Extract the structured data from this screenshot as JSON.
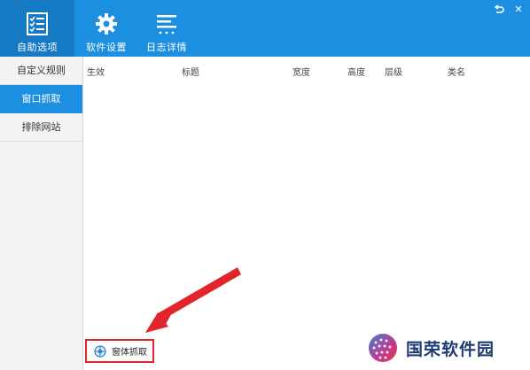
{
  "toolbar": {
    "items": [
      {
        "label": "自助选项",
        "icon": "checklist-icon",
        "active": true
      },
      {
        "label": "软件设置",
        "icon": "gear-icon",
        "active": false
      },
      {
        "label": "日志详情",
        "icon": "log-lines-icon",
        "active": false
      }
    ],
    "controls": {
      "restore_icon": "restore-arrow-icon",
      "close_label": "×"
    }
  },
  "sidebar": {
    "items": [
      {
        "label": "自定义规则",
        "active": false
      },
      {
        "label": "窗口抓取",
        "active": true
      },
      {
        "label": "排除网站",
        "active": false
      }
    ]
  },
  "table": {
    "columns": [
      "生效",
      "标题",
      "宽度",
      "高度",
      "层级",
      "类名"
    ],
    "rows": []
  },
  "action": {
    "label": "窗体抓取",
    "icon": "capture-target-icon",
    "highlight_color": "#e0262a"
  },
  "annotation": {
    "arrow_color": "#e0262a"
  },
  "watermark": {
    "text": "国荣软件园"
  },
  "colors": {
    "accent": "#1c8fe0",
    "accent_dark": "#1579c4"
  }
}
